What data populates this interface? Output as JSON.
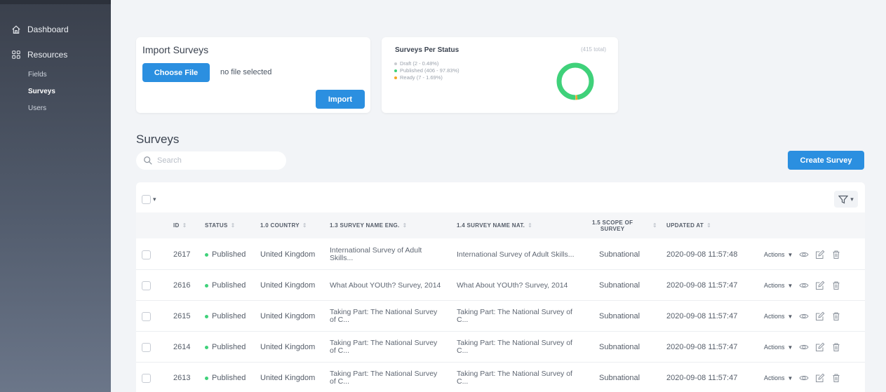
{
  "sidebar": {
    "dashboard": "Dashboard",
    "resources": "Resources",
    "items": [
      {
        "label": "Fields",
        "active": false
      },
      {
        "label": "Surveys",
        "active": true
      },
      {
        "label": "Users",
        "active": false
      }
    ]
  },
  "import_card": {
    "title": "Import Surveys",
    "choose_label": "Choose File",
    "file_status": "no file selected",
    "import_label": "Import"
  },
  "status_card": {
    "title": "Surveys Per Status",
    "total": "(415 total)",
    "legend": [
      {
        "label": "Draft (2 - 0.48%)",
        "color": "#c9ccd1",
        "value": 2
      },
      {
        "label": "Published (406 - 97.83%)",
        "color": "#3fd17a",
        "value": 406
      },
      {
        "label": "Ready (7 - 1.69%)",
        "color": "#f5a623",
        "value": 7
      }
    ]
  },
  "surveys": {
    "title": "Surveys",
    "search_placeholder": "Search",
    "create_label": "Create Survey"
  },
  "table": {
    "headers": {
      "id": "ID",
      "status": "STATUS",
      "country": "1.0 COUNTRY",
      "name_eng": "1.3 SURVEY NAME ENG.",
      "name_nat": "1.4 SURVEY NAME NAT.",
      "scope_line1": "1.5 SCOPE OF",
      "scope_line2": "SURVEY",
      "updated": "UPDATED AT"
    },
    "actions_label": "Actions",
    "rows": [
      {
        "id": "2617",
        "status": "Published",
        "country": "United Kingdom",
        "name_eng": "International Survey of Adult Skills...",
        "name_nat": "International Survey of Adult Skills...",
        "scope": "Subnational",
        "updated": "2020-09-08 11:57:48"
      },
      {
        "id": "2616",
        "status": "Published",
        "country": "United Kingdom",
        "name_eng": "What About YOUth? Survey, 2014",
        "name_nat": "What About YOUth? Survey, 2014",
        "scope": "Subnational",
        "updated": "2020-09-08 11:57:47"
      },
      {
        "id": "2615",
        "status": "Published",
        "country": "United Kingdom",
        "name_eng": "Taking Part: The National Survey of C...",
        "name_nat": "Taking Part: The National Survey of C...",
        "scope": "Subnational",
        "updated": "2020-09-08 11:57:47"
      },
      {
        "id": "2614",
        "status": "Published",
        "country": "United Kingdom",
        "name_eng": "Taking Part: The National Survey of C...",
        "name_nat": "Taking Part: The National Survey of C...",
        "scope": "Subnational",
        "updated": "2020-09-08 11:57:47"
      },
      {
        "id": "2613",
        "status": "Published",
        "country": "United Kingdom",
        "name_eng": "Taking Part: The National Survey of C...",
        "name_nat": "Taking Part: The National Survey of C...",
        "scope": "Subnational",
        "updated": "2020-09-08 11:57:47"
      }
    ]
  }
}
